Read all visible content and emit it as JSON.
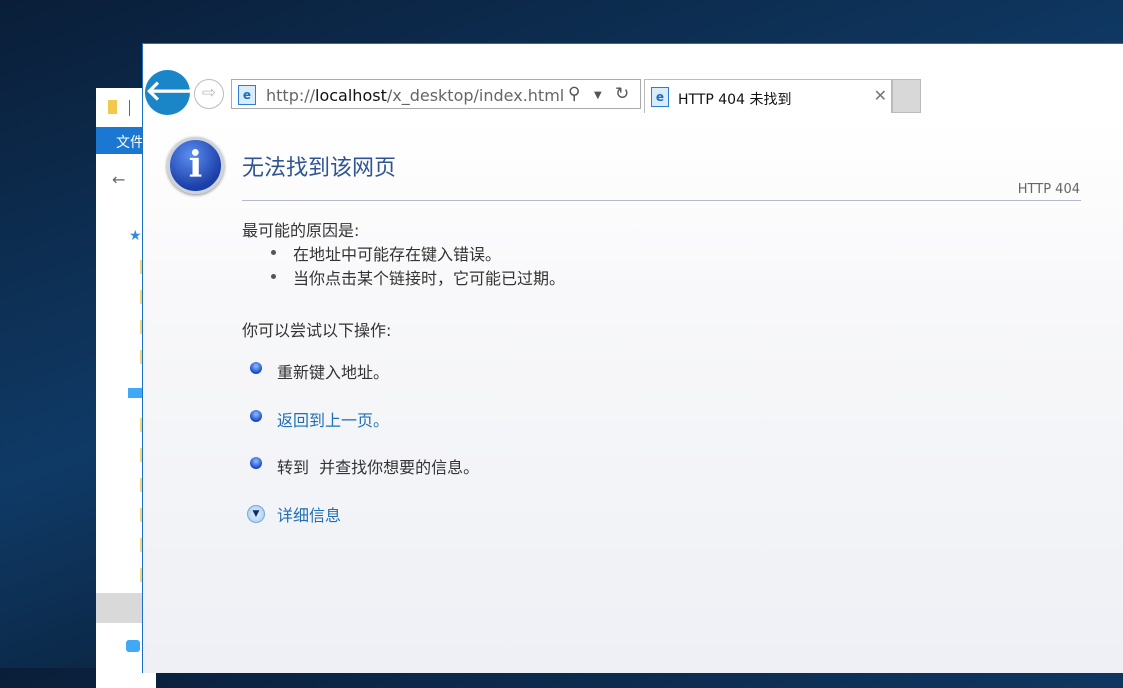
{
  "explorer": {
    "ribbon_label": "文件"
  },
  "browser": {
    "address": {
      "prefix": "http://",
      "host": "localhost",
      "path": "/x_desktop/index.html"
    },
    "tab": {
      "title": "HTTP 404 未找到"
    }
  },
  "page": {
    "title": "无法找到该网页",
    "code": "HTTP 404",
    "causes_heading": "最可能的原因是:",
    "causes": [
      "在地址中可能存在键入错误。",
      "当你点击某个链接时，它可能已过期。"
    ],
    "actions_heading": "你可以尝试以下操作:",
    "actions": [
      "重新键入地址。",
      "返回到上一页。",
      "转到  并查找你想要的信息。"
    ],
    "more_info": "详细信息"
  }
}
